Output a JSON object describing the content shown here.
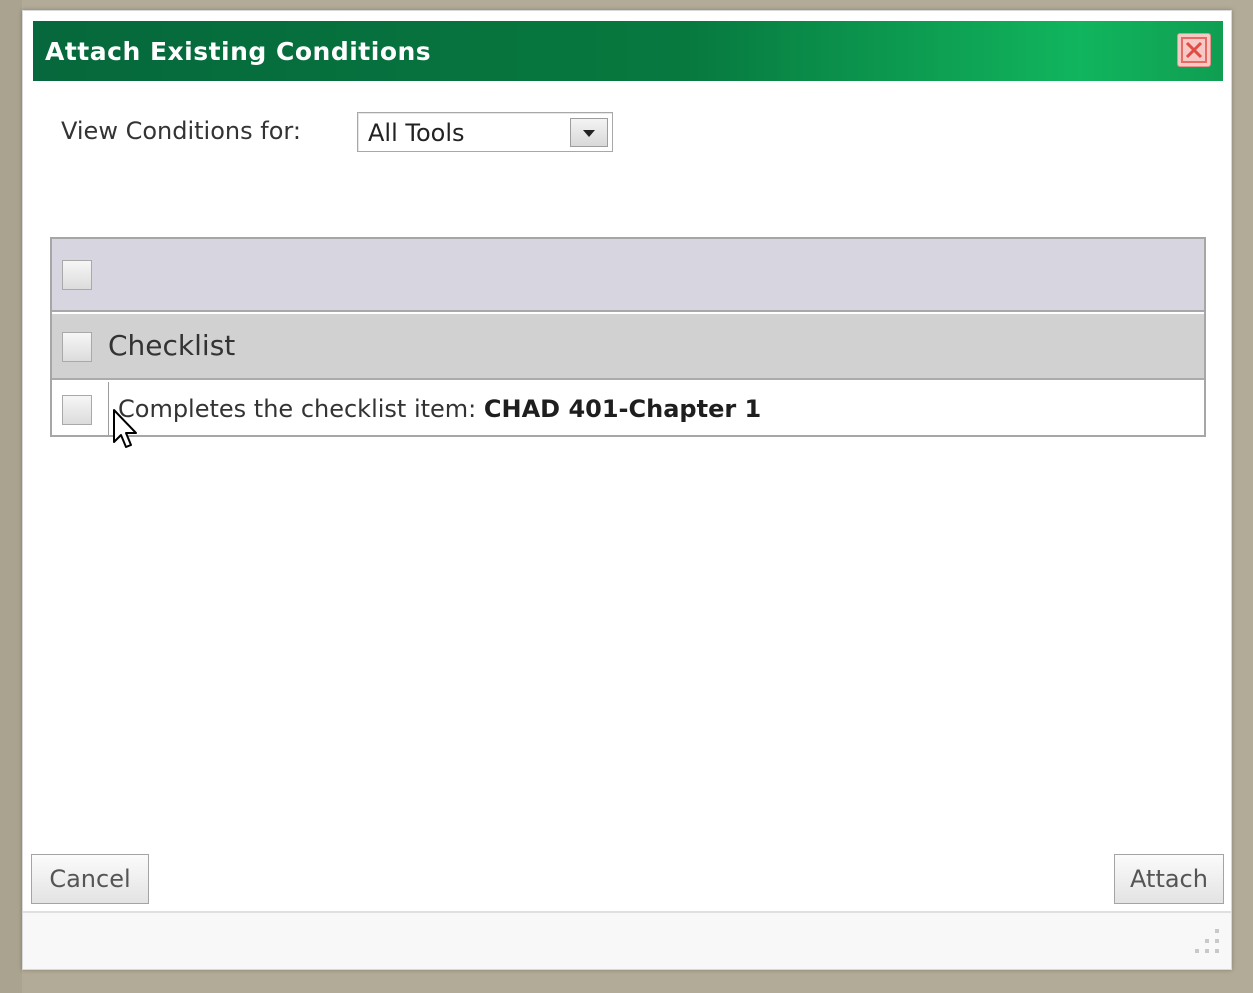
{
  "dialog": {
    "title": "Attach Existing Conditions",
    "close_icon": "close-icon"
  },
  "filter": {
    "label": "View Conditions for:",
    "selected": "All Tools"
  },
  "table": {
    "group_label": "Checklist",
    "item": {
      "prefix": "Completes the checklist item: ",
      "name": "CHAD 401-Chapter 1"
    }
  },
  "buttons": {
    "cancel": "Cancel",
    "attach": "Attach"
  },
  "colors": {
    "titlebar_dark": "#06683c",
    "titlebar_light": "#11b55e",
    "header_row": "#d7d6e0",
    "group_row": "#d1d1d1"
  }
}
